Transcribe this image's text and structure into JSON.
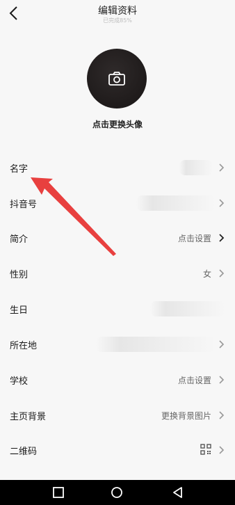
{
  "header": {
    "title": "编辑资料",
    "subtitle": "已完成85%"
  },
  "avatar": {
    "label": "点击更换头像",
    "icon": "camera-icon"
  },
  "rows": [
    {
      "label": "名字",
      "value": ""
    },
    {
      "label": "抖音号",
      "value": ""
    },
    {
      "label": "简介",
      "value": "点击设置"
    },
    {
      "label": "性别",
      "value": "女"
    },
    {
      "label": "生日",
      "value": ""
    },
    {
      "label": "所在地",
      "value": ""
    },
    {
      "label": "学校",
      "value": "点击设置"
    },
    {
      "label": "主页背景",
      "value": "更换背景图片"
    },
    {
      "label": "二维码",
      "value": ""
    }
  ],
  "colors": {
    "background": "#f7f7f7",
    "annotation_arrow": "#e8403f",
    "navbar": "#000000"
  }
}
